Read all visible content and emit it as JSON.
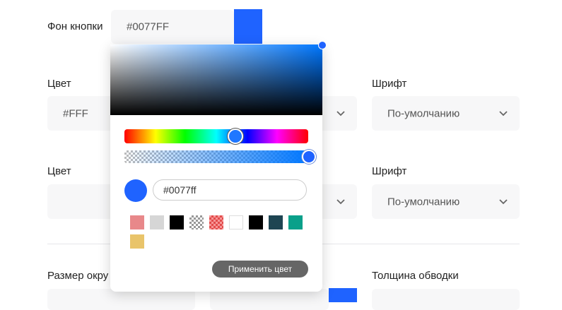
{
  "button_bg": {
    "label": "Фон кнопки",
    "value": "#0077FF",
    "swatch_color": "#1F63FF"
  },
  "row1": {
    "color_label": "Цвет",
    "color_value": "#FFF",
    "font_label": "Шрифт",
    "font_value": "По-умолчанию"
  },
  "row2": {
    "color_label": "Цвет",
    "font_label": "Шрифт",
    "font_value": "По-умолчанию"
  },
  "row3": {
    "radius_label": "Размер окру",
    "stroke_label": "Толщина обводки"
  },
  "picker": {
    "base_hue_color": "#0077FF",
    "hex_value": "#0077ff",
    "apply_label": "Применить цвет",
    "swatches": [
      {
        "name": "swatch-pink",
        "color": "#E8888A"
      },
      {
        "name": "swatch-light-gray",
        "color": "#D6D6D6"
      },
      {
        "name": "swatch-black",
        "color": "#000000"
      },
      {
        "name": "swatch-transparent",
        "color": "transparent"
      },
      {
        "name": "swatch-red-transparent",
        "color": "rgba(240,80,80,0.6)"
      },
      {
        "name": "swatch-white",
        "color": "#FFFFFF"
      },
      {
        "name": "swatch-black-2",
        "color": "#000000"
      },
      {
        "name": "swatch-dark-teal",
        "color": "#1E4552"
      },
      {
        "name": "swatch-teal",
        "color": "#0AA08A"
      },
      {
        "name": "swatch-yellow",
        "color": "#E9C46A"
      }
    ]
  }
}
